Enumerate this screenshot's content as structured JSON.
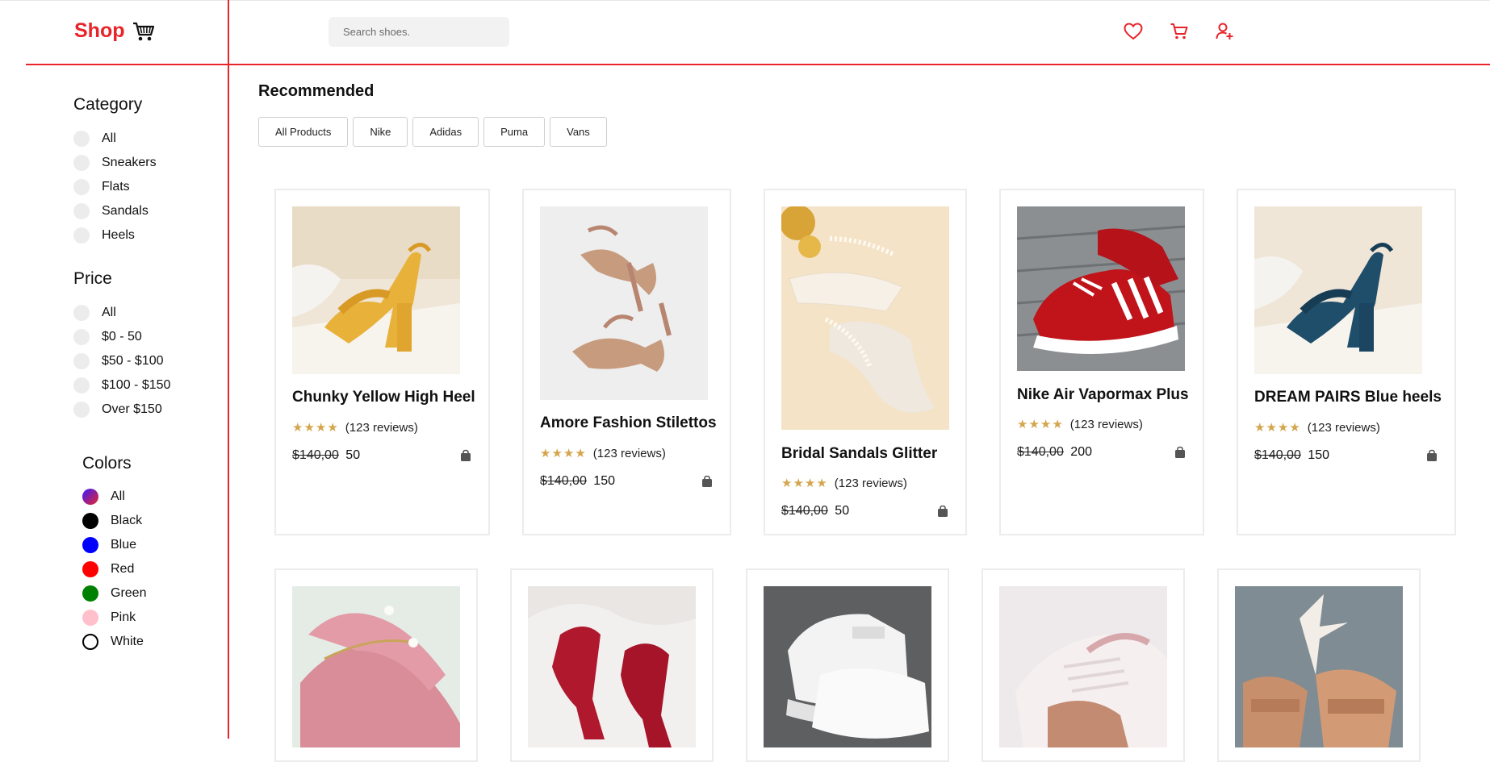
{
  "header": {
    "logo": "Shop",
    "search_placeholder": "Search shoes.",
    "icons": [
      "heart-icon",
      "cart-icon",
      "user-add-icon"
    ]
  },
  "sidebar": {
    "category": {
      "title": "Category",
      "options": [
        "All",
        "Sneakers",
        "Flats",
        "Sandals",
        "Heels"
      ]
    },
    "price": {
      "title": "Price",
      "options": [
        "All",
        "$0 - 50",
        "$50 - $100",
        "$100 - $150",
        "Over $150"
      ]
    },
    "colors": {
      "title": "Colors",
      "options": [
        {
          "label": "All",
          "color": "gradient"
        },
        {
          "label": "Black",
          "color": "#000000"
        },
        {
          "label": "Blue",
          "color": "#0000ff"
        },
        {
          "label": "Red",
          "color": "#ff0000"
        },
        {
          "label": "Green",
          "color": "#008000"
        },
        {
          "label": "Pink",
          "color": "#ffc0cb"
        },
        {
          "label": "White",
          "color": "#ffffff"
        }
      ]
    }
  },
  "main": {
    "title": "Recommended",
    "filters": [
      "All Products",
      "Nike",
      "Adidas",
      "Puma",
      "Vans"
    ],
    "products": [
      {
        "title": "Chunky Yellow High Heel",
        "stars": "★★★★",
        "reviews": "(123 reviews)",
        "old_price": "$140,00",
        "price": "50"
      },
      {
        "title": "Amore Fashion Stilettos",
        "stars": "★★★★",
        "reviews": "(123 reviews)",
        "old_price": "$140,00",
        "price": "150"
      },
      {
        "title": "Bridal Sandals Glitter",
        "stars": "★★★★",
        "reviews": "(123 reviews)",
        "old_price": "$140,00",
        "price": "50"
      },
      {
        "title": "Nike Air Vapormax Plus",
        "stars": "★★★★",
        "reviews": "(123 reviews)",
        "old_price": "$140,00",
        "price": "200"
      },
      {
        "title": "DREAM PAIRS Blue heels",
        "stars": "★★★★",
        "reviews": "(123 reviews)",
        "old_price": "$140,00",
        "price": "150"
      }
    ]
  },
  "colors": {
    "accent": "#e8242b",
    "star": "#d4a54c"
  }
}
